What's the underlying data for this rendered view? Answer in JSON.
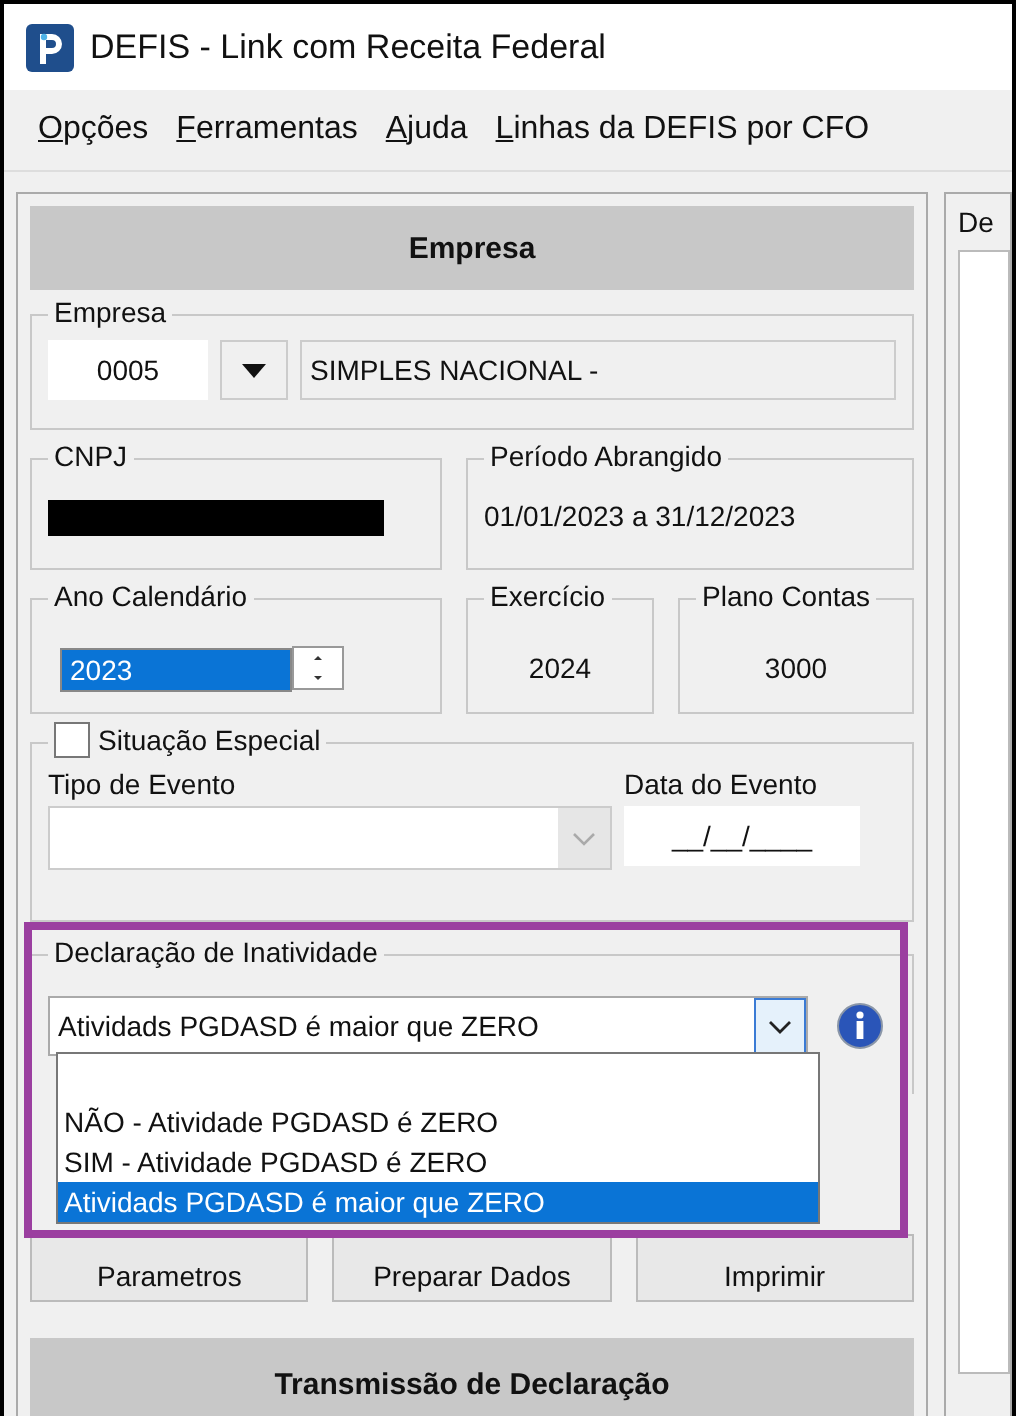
{
  "window": {
    "title": "DEFIS - Link com Receita Federal"
  },
  "menu": [
    {
      "label": "Opções"
    },
    {
      "label": "Ferramentas"
    },
    {
      "label": "Ajuda"
    },
    {
      "label": "Linhas da DEFIS por CFO"
    }
  ],
  "empresa_section": {
    "title": "Empresa"
  },
  "empresa": {
    "label": "Empresa",
    "code": "0005",
    "name": "SIMPLES NACIONAL -"
  },
  "cnpj": {
    "label": "CNPJ",
    "redacted": true
  },
  "periodo": {
    "label": "Período Abrangido",
    "value": "01/01/2023 a 31/12/2023"
  },
  "ano_calendario": {
    "label": "Ano Calendário",
    "value": "2023"
  },
  "exercicio": {
    "label": "Exercício",
    "value": "2024"
  },
  "plano_contas": {
    "label": "Plano Contas",
    "value": "3000"
  },
  "situacao_especial": {
    "label": "Situação Especial",
    "checked": false,
    "tipo_label": "Tipo de Evento",
    "data_label": "Data do Evento",
    "data_value": "__/__/____"
  },
  "inatividade": {
    "label": "Declaração de Inatividade",
    "value": "Atividads PGDASD é maior que ZERO",
    "highlighted": true,
    "options": [
      {
        "label": "NÃO - Atividade PGDASD é ZERO",
        "selected": false
      },
      {
        "label": "SIM - Atividade PGDASD é ZERO",
        "selected": false
      },
      {
        "label": "Atividads PGDASD é maior que ZERO",
        "selected": true
      }
    ]
  },
  "buttons": [
    "Parametros",
    "Preparar Dados",
    "Imprimir"
  ],
  "transmissao_section": {
    "title": "Transmissão de Declaração"
  },
  "right_panel": {
    "tab": "De"
  }
}
